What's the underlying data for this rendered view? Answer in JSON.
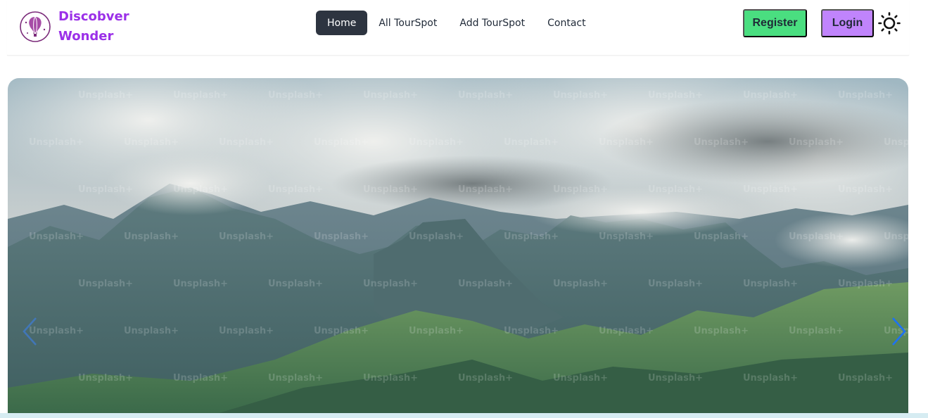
{
  "brand": {
    "name_line1": "Discobver",
    "name_line2": "Wonder",
    "logo_icon": "hot-air-balloon-icon",
    "color": "#9b30e8"
  },
  "nav": {
    "items": [
      {
        "label": "Home",
        "active": true
      },
      {
        "label": "All TourSpot",
        "active": false
      },
      {
        "label": "Add TourSpot",
        "active": false
      },
      {
        "label": "Contact",
        "active": false
      }
    ]
  },
  "actions": {
    "register_label": "Register",
    "login_label": "Login",
    "register_color": "#4ade80",
    "login_color": "#c084fc",
    "theme_icon": "sun-icon"
  },
  "hero": {
    "image": "mountain-landscape-image",
    "watermark_text": "Unsplash+",
    "prev_icon": "chevron-left-icon",
    "next_icon": "chevron-right-icon"
  }
}
